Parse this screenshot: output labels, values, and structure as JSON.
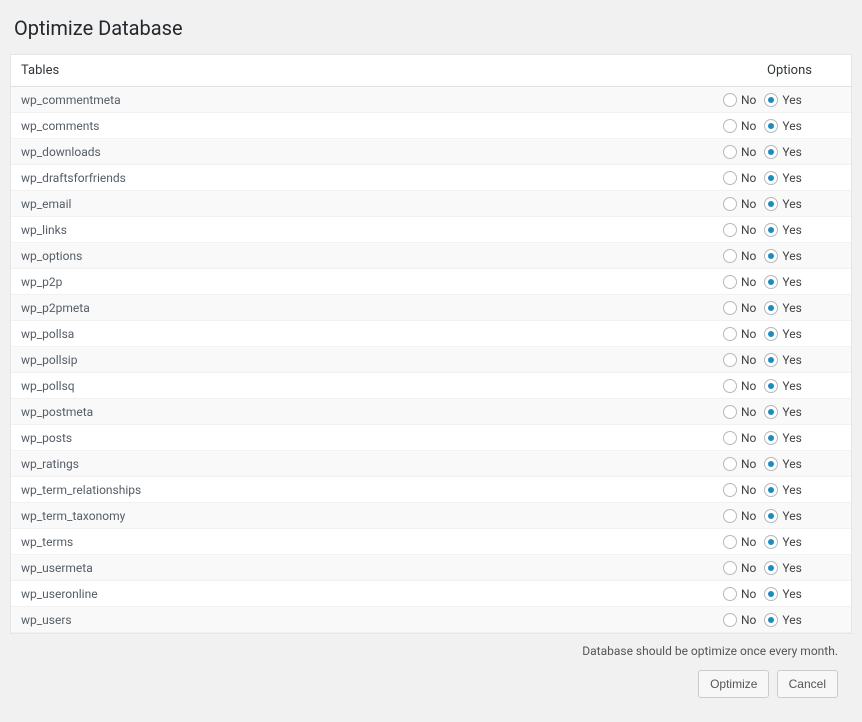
{
  "page_title": "Optimize Database",
  "headers": {
    "tables": "Tables",
    "options": "Options"
  },
  "option_labels": {
    "no": "No",
    "yes": "Yes"
  },
  "tables": [
    {
      "name": "wp_commentmeta",
      "selected": "yes"
    },
    {
      "name": "wp_comments",
      "selected": "yes"
    },
    {
      "name": "wp_downloads",
      "selected": "yes"
    },
    {
      "name": "wp_draftsforfriends",
      "selected": "yes"
    },
    {
      "name": "wp_email",
      "selected": "yes"
    },
    {
      "name": "wp_links",
      "selected": "yes"
    },
    {
      "name": "wp_options",
      "selected": "yes"
    },
    {
      "name": "wp_p2p",
      "selected": "yes"
    },
    {
      "name": "wp_p2pmeta",
      "selected": "yes"
    },
    {
      "name": "wp_pollsa",
      "selected": "yes"
    },
    {
      "name": "wp_pollsip",
      "selected": "yes"
    },
    {
      "name": "wp_pollsq",
      "selected": "yes"
    },
    {
      "name": "wp_postmeta",
      "selected": "yes"
    },
    {
      "name": "wp_posts",
      "selected": "yes"
    },
    {
      "name": "wp_ratings",
      "selected": "yes"
    },
    {
      "name": "wp_term_relationships",
      "selected": "yes"
    },
    {
      "name": "wp_term_taxonomy",
      "selected": "yes"
    },
    {
      "name": "wp_terms",
      "selected": "yes"
    },
    {
      "name": "wp_usermeta",
      "selected": "yes"
    },
    {
      "name": "wp_useronline",
      "selected": "yes"
    },
    {
      "name": "wp_users",
      "selected": "yes"
    }
  ],
  "footer_note": "Database should be optimize once every month.",
  "buttons": {
    "optimize": "Optimize",
    "cancel": "Cancel"
  }
}
